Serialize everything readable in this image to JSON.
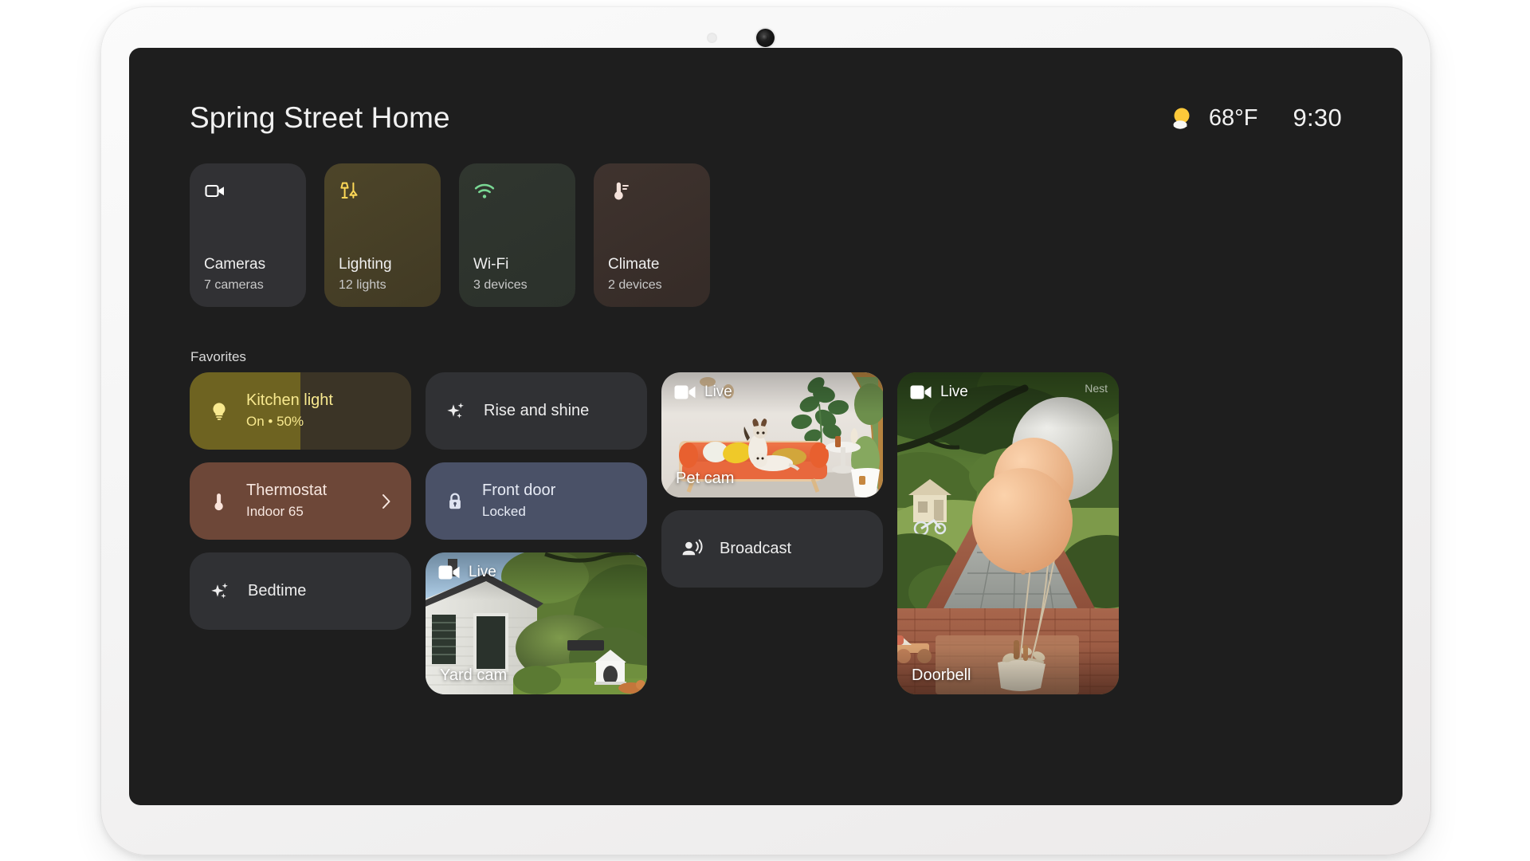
{
  "device": {
    "frame_color": "#f5f4f3",
    "screen_bg": "#1e1e1e"
  },
  "header": {
    "home_name": "Spring Street Home",
    "weather_icon": "sun-behind-cloud-icon",
    "temperature": "68°F",
    "time": "9:30"
  },
  "quick_cards": [
    {
      "icon": "video-camera-icon",
      "title": "Cameras",
      "subtitle": "7 cameras",
      "bg": "#313134",
      "icon_color": "#ffffff"
    },
    {
      "icon": "lamp-icon",
      "title": "Lighting",
      "subtitle": "12 lights",
      "bg": "#4a4327",
      "icon_color": "#fcd757"
    },
    {
      "icon": "wifi-icon",
      "title": "Wi-Fi",
      "subtitle": "3 devices",
      "bg": "#2f3530",
      "icon_color": "#73d78a"
    },
    {
      "icon": "thermometer-icon",
      "title": "Climate",
      "subtitle": "2 devices",
      "bg": "#3b302c",
      "icon_color": "#f2ddd6"
    }
  ],
  "favorites": {
    "section_label": "Favorites",
    "kitchen_light": {
      "icon": "lightbulb-icon",
      "title": "Kitchen light",
      "subtitle": "On • 50%",
      "brightness_percent": 50,
      "fill_color": "#6e6321",
      "track_color": "#3b3426",
      "text_color": "#f8e98f"
    },
    "rise_and_shine": {
      "icon": "sparkle-icon",
      "title": "Rise and shine"
    },
    "thermostat": {
      "icon": "thermometer-icon",
      "title": "Thermostat",
      "subtitle": "Indoor 65",
      "bg": "#6d4738",
      "text_color": "#f7e7e0",
      "chevron": "chevron-right-icon"
    },
    "front_door": {
      "icon": "lock-closed-icon",
      "title": "Front door",
      "subtitle": "Locked",
      "bg": "#4a5167",
      "text_color": "#e7ebf5"
    },
    "bedtime": {
      "icon": "sparkle-icon",
      "title": "Bedtime"
    },
    "broadcast": {
      "icon": "broadcast-icon",
      "title": "Broadcast"
    },
    "cameras": [
      {
        "name": "Pet cam",
        "live_label": "Live",
        "live_icon": "video-camera-icon",
        "brand": ""
      },
      {
        "name": "Yard cam",
        "live_label": "Live",
        "live_icon": "video-camera-icon",
        "brand": ""
      },
      {
        "name": "Doorbell",
        "live_label": "Live",
        "live_icon": "video-camera-icon",
        "brand": "Nest"
      }
    ]
  }
}
